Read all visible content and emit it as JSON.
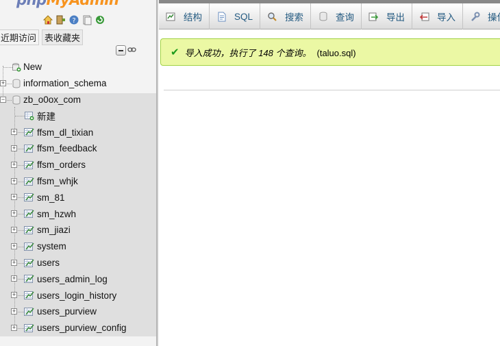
{
  "logo": {
    "part1": "php",
    "part2": "MyAdmin"
  },
  "nav_icons": [
    "home-icon",
    "exit-icon",
    "help-icon",
    "docs-icon",
    "reload-icon"
  ],
  "nav_links": {
    "recent": "近期访问",
    "favorites": "表收藏夹"
  },
  "tree": {
    "new_label": "New",
    "databases": [
      {
        "name": "information_schema",
        "expanded": false
      },
      {
        "name": "zb_o0ox_com",
        "expanded": true
      }
    ],
    "new_table_label": "新建",
    "tables": [
      "ffsm_dl_tixian",
      "ffsm_feedback",
      "ffsm_orders",
      "ffsm_whjk",
      "sm_81",
      "sm_hzwh",
      "sm_jiazi",
      "system",
      "users",
      "users_admin_log",
      "users_login_history",
      "users_purview",
      "users_purview_config"
    ]
  },
  "menu": {
    "tabs": [
      {
        "label": "结构",
        "icon": "structure-icon"
      },
      {
        "label": "SQL",
        "icon": "sql-icon"
      },
      {
        "label": "搜索",
        "icon": "search-icon"
      },
      {
        "label": "查询",
        "icon": "query-icon"
      },
      {
        "label": "导出",
        "icon": "export-icon"
      },
      {
        "label": "导入",
        "icon": "import-icon"
      },
      {
        "label": "操作",
        "icon": "operations-icon"
      }
    ]
  },
  "notice": {
    "text": "导入成功，执行了 148 个查询。",
    "file": "(taluo.sql)"
  },
  "colors": {
    "nav_bg": "#f3f3f3",
    "success_bg": "#ebf8a4",
    "success_border": "#a2d246",
    "link": "#235a81"
  }
}
